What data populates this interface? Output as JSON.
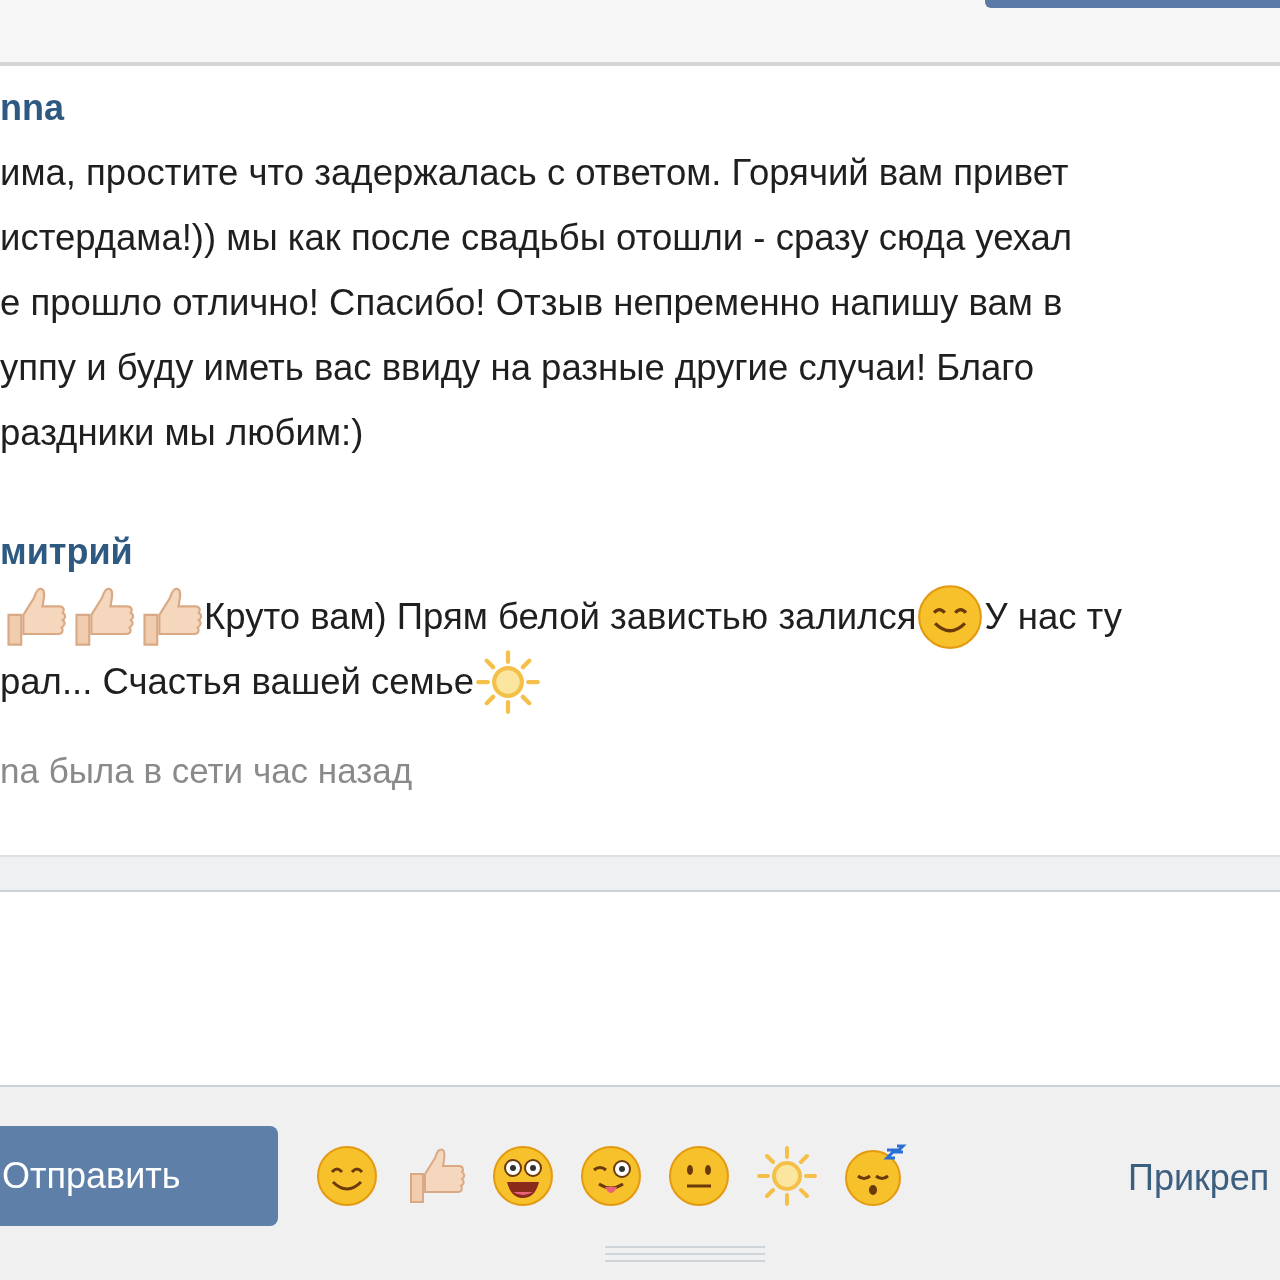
{
  "messages": [
    {
      "author": "nna",
      "lines": [
        [
          {
            "kind": "text",
            "text": "има, простите что задержалась с ответом. Горячий вам привет"
          }
        ],
        [
          {
            "kind": "text",
            "text": "истердама!)) мы как после свадьбы отошли - сразу сюда уехал"
          }
        ],
        [
          {
            "kind": "text",
            "text": "е прошло отлично! Спасибо! Отзыв непременно напишу вам в"
          }
        ],
        [
          {
            "kind": "text",
            "text": "уппу и буду иметь вас ввиду на разные другие случаи! Благо"
          }
        ],
        [
          {
            "kind": "text",
            "text": "раздники мы любим:)"
          }
        ]
      ]
    },
    {
      "author": "митрий",
      "lines": [
        [
          {
            "kind": "thumbs-up"
          },
          {
            "kind": "thumbs-up"
          },
          {
            "kind": "thumbs-up"
          },
          {
            "kind": "text",
            "text": "Круто вам) Прям белой завистью залился"
          },
          {
            "kind": "smile"
          },
          {
            "kind": "text",
            "text": " У нас ту"
          }
        ],
        [
          {
            "kind": "text",
            "text": "рал... Счастья вашей семье"
          },
          {
            "kind": "sun"
          }
        ]
      ]
    }
  ],
  "status": "na была в сети час назад",
  "send_button": "Отправить",
  "emoji_bar": [
    {
      "kind": "smile"
    },
    {
      "kind": "thumbs-up"
    },
    {
      "kind": "grin"
    },
    {
      "kind": "wink"
    },
    {
      "kind": "neutral"
    },
    {
      "kind": "sun"
    },
    {
      "kind": "sleepy"
    }
  ],
  "attach_link": "Прикреп"
}
